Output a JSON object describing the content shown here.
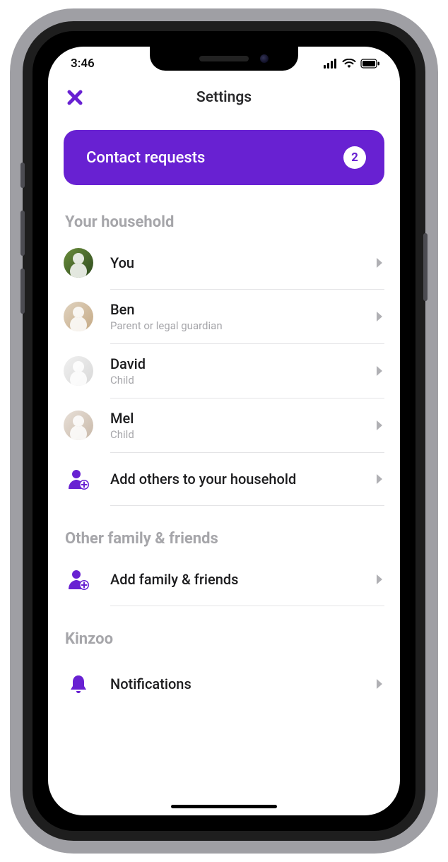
{
  "colors": {
    "accent": "#6821D2",
    "muted": "#a6a6aa",
    "text": "#1c1c1e"
  },
  "status": {
    "time": "3:46"
  },
  "header": {
    "title": "Settings"
  },
  "banner": {
    "label": "Contact requests",
    "badge": "2"
  },
  "sections": {
    "household": {
      "title": "Your household",
      "members": [
        {
          "name": "You",
          "role": ""
        },
        {
          "name": "Ben",
          "role": "Parent or legal guardian"
        },
        {
          "name": "David",
          "role": "Child"
        },
        {
          "name": "Mel",
          "role": "Child"
        }
      ],
      "add_label": "Add others to your household"
    },
    "friends": {
      "title": "Other family & friends",
      "add_label": "Add family & friends"
    },
    "kinzoo": {
      "title": "Kinzoo",
      "items": [
        {
          "label": "Notifications"
        }
      ]
    }
  }
}
